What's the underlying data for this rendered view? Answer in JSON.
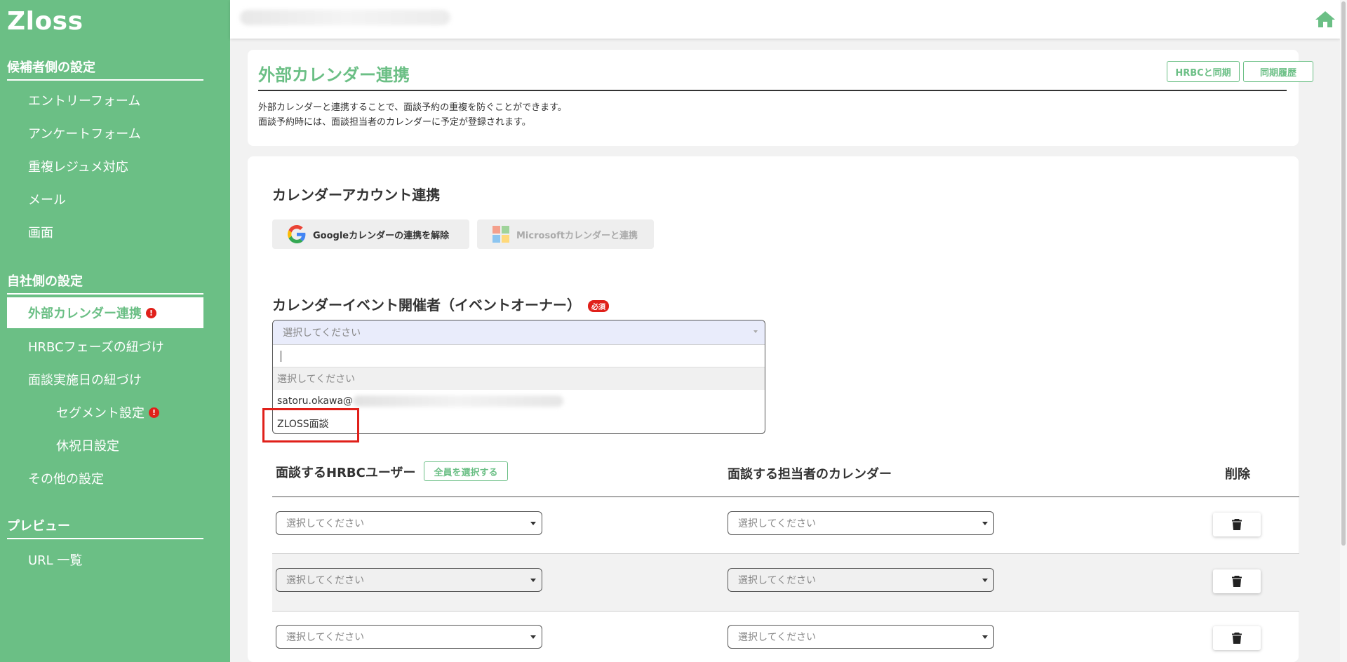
{
  "sidebar": {
    "logo": "Zloss",
    "section1_title": "候補者側の設定",
    "section1_items": [
      "エントリーフォーム",
      "アンケートフォーム",
      "重複レジュメ対応",
      "メール",
      "画面"
    ],
    "section2_title": "自社側の設定",
    "section2_items": [
      "外部カレンダー連携",
      "HRBCフェーズの紐づけ",
      "面談実施日の紐づけ",
      "セグメント設定",
      "休祝日設定",
      "その他の設定"
    ],
    "section3_title": "プレビュー",
    "section3_items": [
      "URL 一覧"
    ],
    "alert_mark": "!"
  },
  "header": {
    "title": "外部カレンダー連携",
    "btn_sync": "HRBCと同期",
    "btn_history": "同期履歴",
    "desc_line1": "外部カレンダーと連携することで、面談予約の重複を防ぐことができます。",
    "desc_line2": "面談予約時には、面談担当者のカレンダーに予定が登録されます。"
  },
  "account": {
    "title": "カレンダーアカウント連携",
    "google_btn": "Googleカレンダーの連携を解除",
    "microsoft_btn": "Microsoftカレンダーと連携"
  },
  "organizer": {
    "title": "カレンダーイベント開催者（イベントオーナー）",
    "required": "必須",
    "placeholder": "選択してください",
    "options": [
      "選択してください",
      "satoru.okawa@",
      "ZLOSS面談"
    ]
  },
  "table": {
    "col_user": "面談するHRBCユーザー",
    "select_all": "全員を選択する",
    "col_calendar": "面談する担当者のカレンダー",
    "col_delete": "削除",
    "rows": [
      {
        "user": "選択してください",
        "calendar": "選択してください"
      },
      {
        "user": "選択してください",
        "calendar": "選択してください"
      },
      {
        "user": "選択してください",
        "calendar": "選択してください"
      }
    ]
  },
  "colors": {
    "accent": "#6bbf85",
    "alert": "#e0201a"
  }
}
